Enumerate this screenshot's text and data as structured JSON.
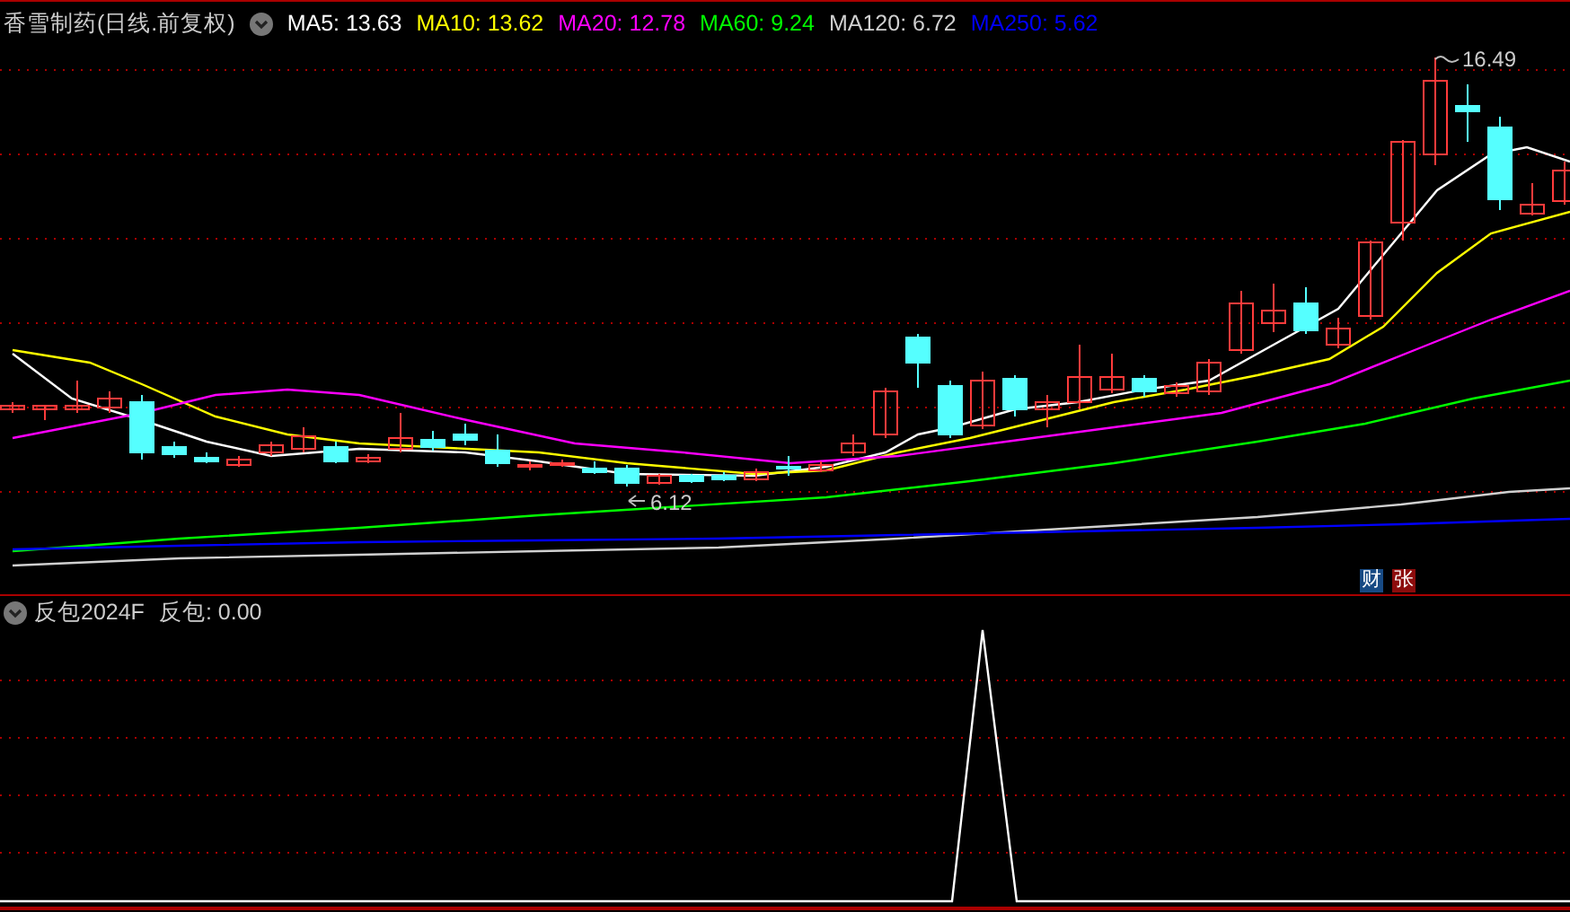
{
  "chart": {
    "title": "香雪制药(日线.前复权)",
    "ma": [
      {
        "label": "MA5: 13.63",
        "color": "#ffffff"
      },
      {
        "label": "MA10: 13.62",
        "color": "#ffff00"
      },
      {
        "label": "MA20: 12.78",
        "color": "#ff00ff"
      },
      {
        "label": "MA60: 9.24",
        "color": "#00ff00"
      },
      {
        "label": "MA120: 6.72",
        "color": "#d0d0d0"
      },
      {
        "label": "MA250: 5.62",
        "color": "#0000ff"
      }
    ],
    "high_label": "16.49",
    "low_label": "6.12",
    "badges": [
      {
        "text": "财",
        "color": "#174a84"
      },
      {
        "text": "张",
        "color": "#8c0c0c"
      }
    ]
  },
  "indicator": {
    "title": "反包2024F",
    "value": "反包: 0.00"
  }
}
